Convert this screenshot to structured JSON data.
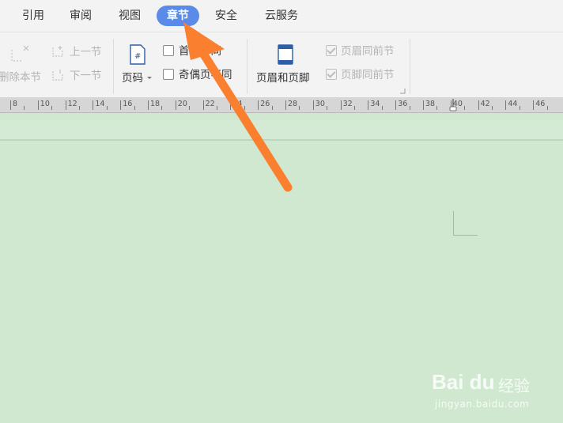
{
  "menu": {
    "tabs": [
      {
        "label": "引用"
      },
      {
        "label": "审阅"
      },
      {
        "label": "视图"
      },
      {
        "label": "章节"
      },
      {
        "label": "安全"
      },
      {
        "label": "云服务"
      }
    ],
    "active_tab": "章节",
    "active_color": "#5b8be8"
  },
  "ribbon": {
    "delete_section": "删除本节",
    "prev_section": "上一节",
    "next_section": "下一节",
    "page_number": "页码",
    "first_page_diff": "首页不同",
    "odd_even_diff": "奇偶页不同",
    "header_footer": "页眉和页脚",
    "header_same_prev": "页眉同前节",
    "footer_same_prev": "页脚同前节"
  },
  "ruler": {
    "labels": [
      "8",
      "10",
      "12",
      "14",
      "16",
      "18",
      "20",
      "22",
      "24",
      "26",
      "28",
      "30",
      "32",
      "34",
      "36",
      "38",
      "40",
      "42",
      "44",
      "46"
    ]
  },
  "annotation": {
    "arrow_color": "#fa8030"
  },
  "watermark": {
    "logo": "Bai du",
    "brand": "经验",
    "url": "jingyan.baidu.com"
  }
}
